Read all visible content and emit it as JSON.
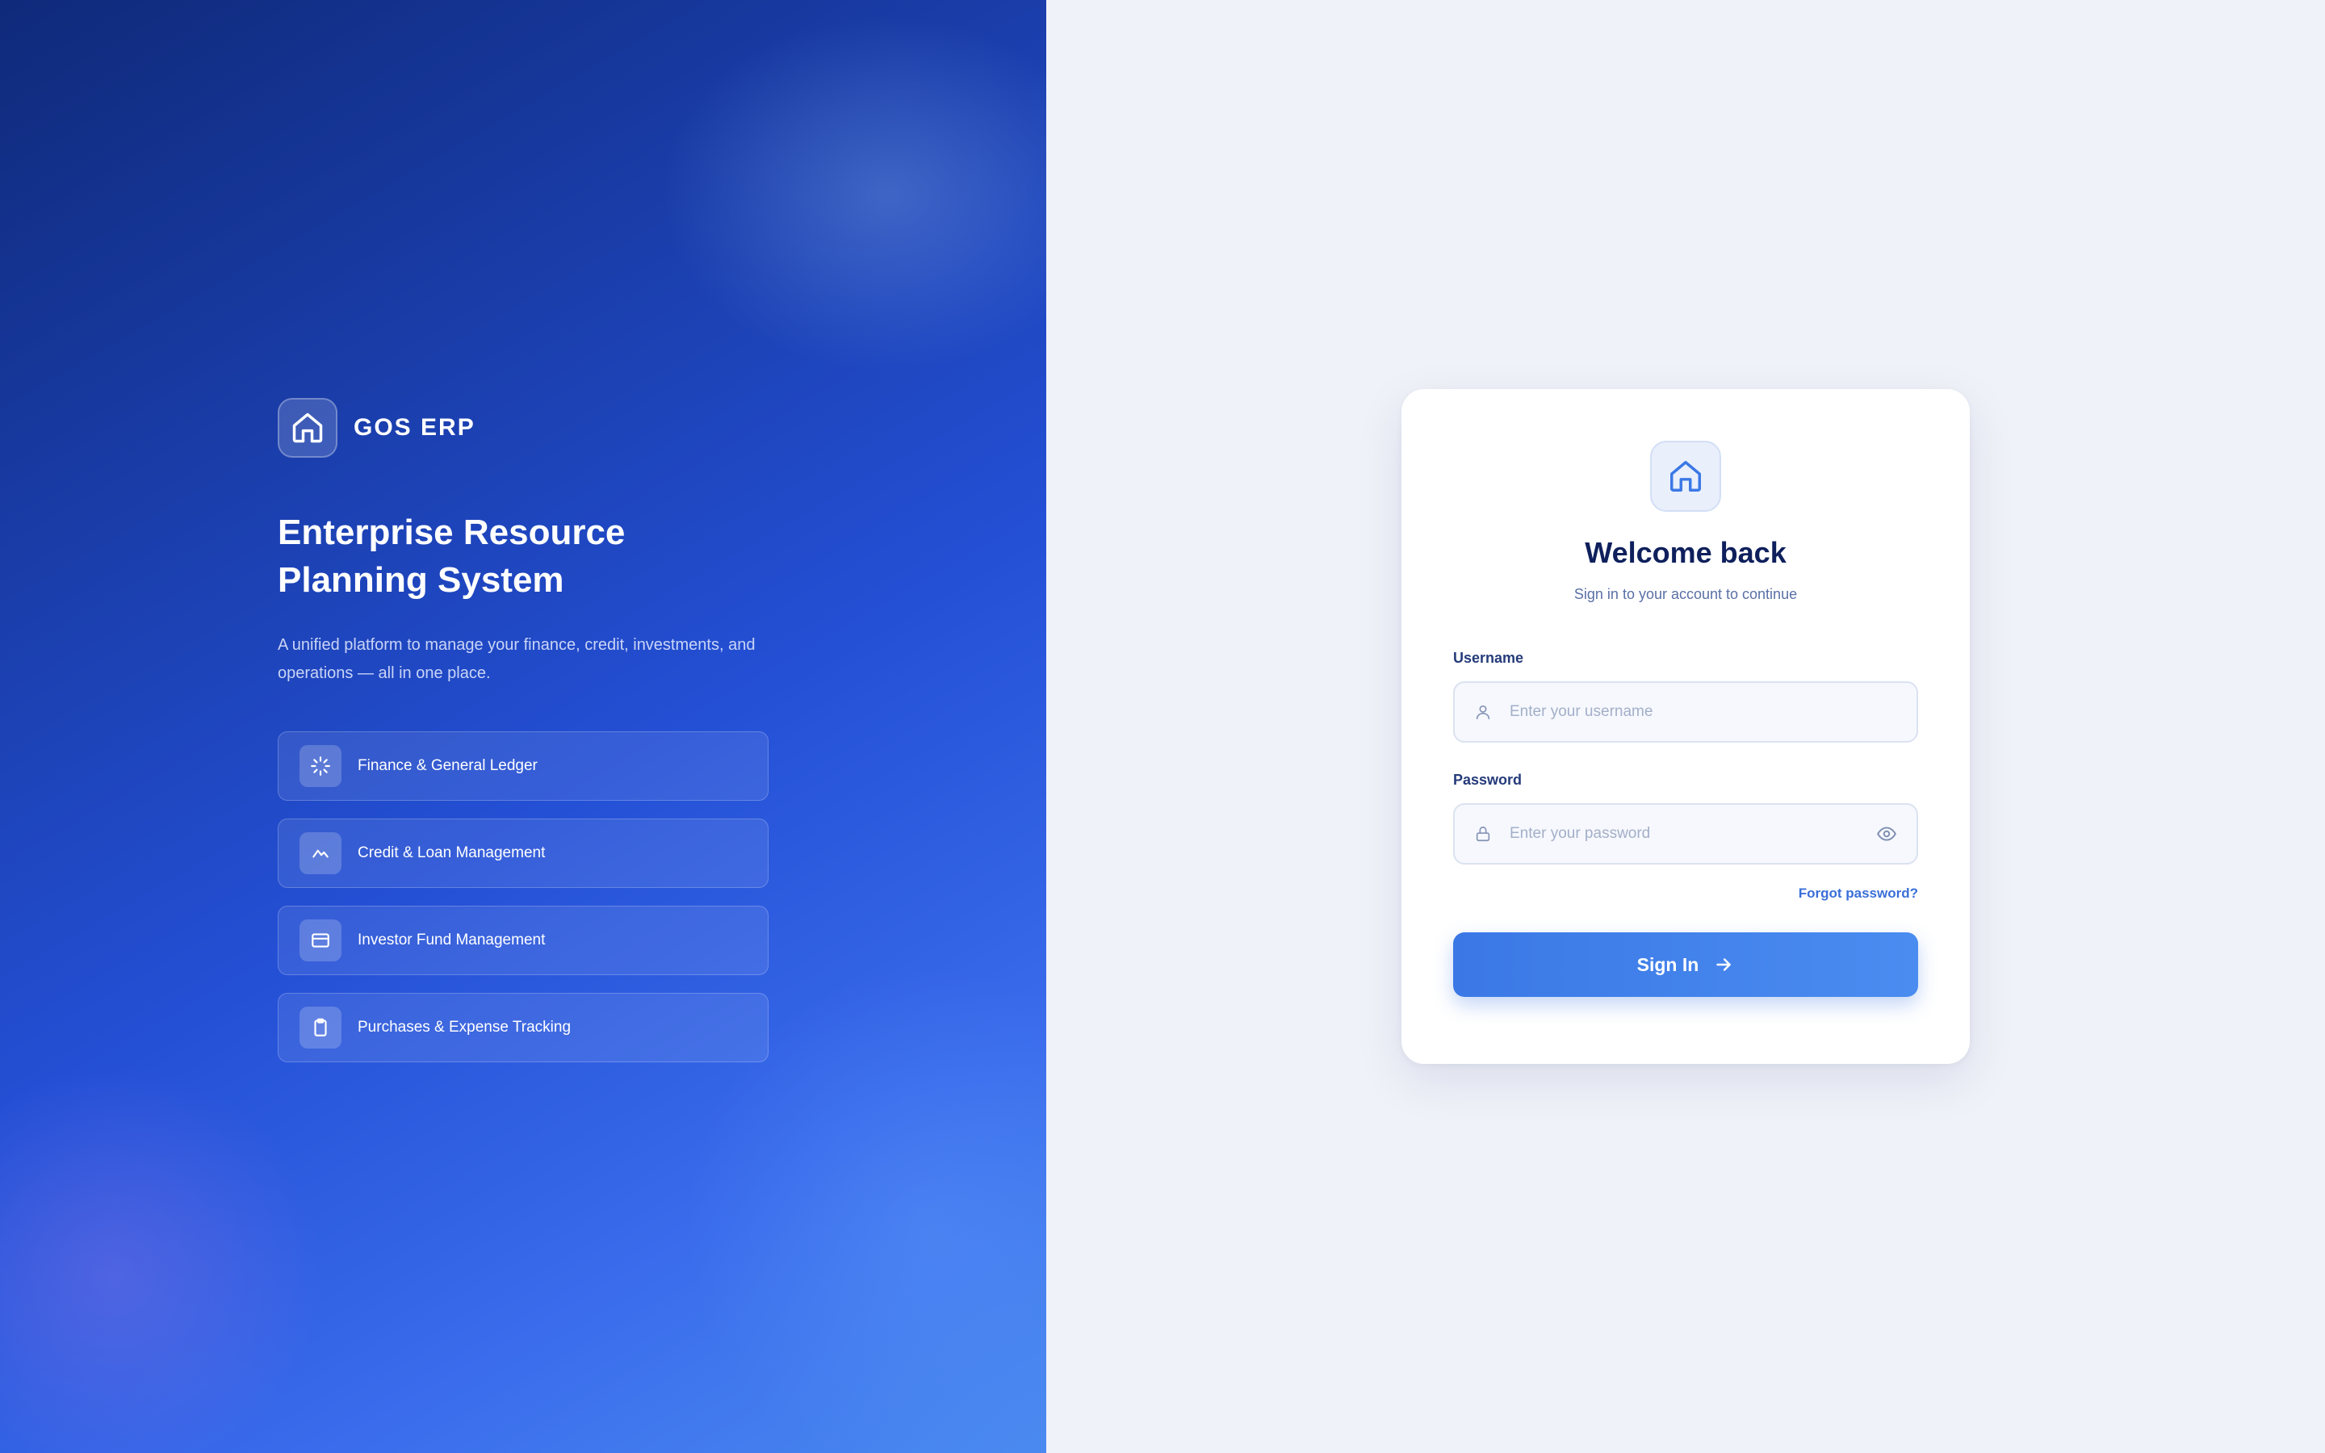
{
  "brand": {
    "name": "GOS ERP",
    "logo_icon": "home-icon"
  },
  "hero": {
    "title_line1": "Enterprise Resource",
    "title_line2": "Planning System",
    "description": "A unified platform to manage your finance, credit, investments, and operations — all in one place.",
    "features": [
      {
        "label": "Finance & General Ledger",
        "icon": "loader-icon"
      },
      {
        "label": "Credit & Loan Management",
        "icon": "chart-line-icon"
      },
      {
        "label": "Investor Fund Management",
        "icon": "credit-card-icon"
      },
      {
        "label": "Purchases & Expense Tracking",
        "icon": "clipboard-icon"
      }
    ]
  },
  "login": {
    "logo_icon": "home-icon",
    "title": "Welcome back",
    "subtitle": "Sign in to your account to continue",
    "username_label": "Username",
    "username_placeholder": "Enter your username",
    "username_value": "",
    "password_label": "Password",
    "password_placeholder": "Enter your password",
    "password_value": "",
    "forgot_label": "Forgot password?",
    "signin_label": "Sign In"
  },
  "colors": {
    "hero_dark": "#0f2a7a",
    "hero_light": "#4a8af0",
    "background": "#f0f2f9",
    "accent": "#3b78e6",
    "title": "#0e1f5c"
  }
}
